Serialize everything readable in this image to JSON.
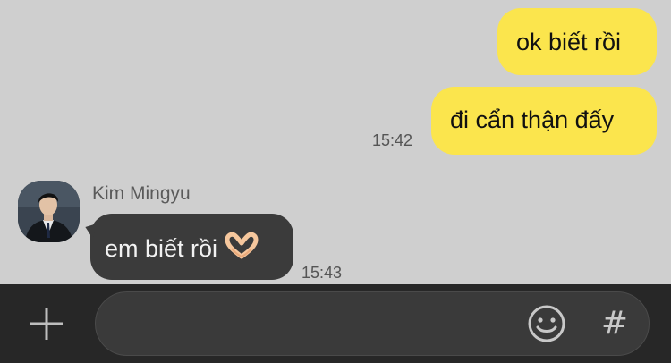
{
  "messages": {
    "outgoing_1": "ok biết rồi",
    "outgoing_2": "đi cẩn thận đấy",
    "outgoing_time": "15:42",
    "incoming_sender": "Kim Mingyu",
    "incoming_1": "em biết rồi",
    "incoming_emoji": "heart-hands-emoji",
    "incoming_time": "15:43"
  },
  "input_bar": {
    "message_value": "",
    "placeholder": "",
    "plus_icon": "plus-icon",
    "emoji_icon": "emoji-smile-icon",
    "hashtag_icon": "hashtag-icon",
    "hashtag_glyph": "#"
  },
  "colors": {
    "chat_background": "#cfcfcf",
    "outgoing_bubble": "#fbe54d",
    "incoming_bubble": "#3b3b3b",
    "input_bar_background": "#272727"
  }
}
